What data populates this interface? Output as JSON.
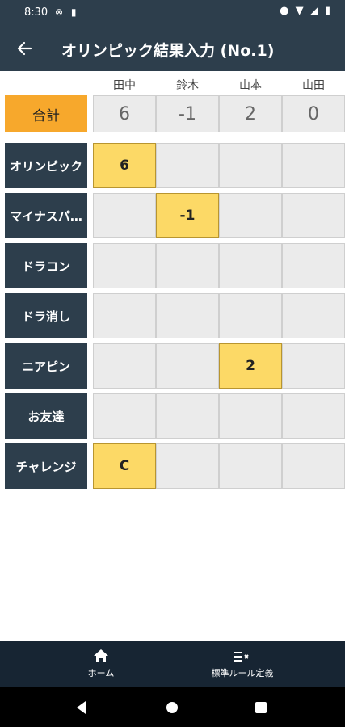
{
  "status": {
    "time": "8:30"
  },
  "appbar": {
    "title": "オリンピック結果入力 (No.1)"
  },
  "players": [
    "田中",
    "鈴木",
    "山本",
    "山田"
  ],
  "total": {
    "label": "合計",
    "scores": [
      "6",
      "-1",
      "2",
      "0"
    ]
  },
  "rows": [
    {
      "label": "オリンピック",
      "scores": [
        "6",
        "",
        "",
        ""
      ]
    },
    {
      "label": "マイナスパ…",
      "scores": [
        "",
        "-1",
        "",
        ""
      ]
    },
    {
      "label": "ドラコン",
      "scores": [
        "",
        "",
        "",
        ""
      ]
    },
    {
      "label": "ドラ消し",
      "scores": [
        "",
        "",
        "",
        ""
      ]
    },
    {
      "label": "ニアピン",
      "scores": [
        "",
        "",
        "2",
        ""
      ]
    },
    {
      "label": "お友達",
      "scores": [
        "",
        "",
        "",
        ""
      ]
    },
    {
      "label": "チャレンジ",
      "scores": [
        "C",
        "",
        "",
        ""
      ]
    }
  ],
  "bottom_nav": [
    {
      "label": "ホーム",
      "icon": "home-icon"
    },
    {
      "label": "標準ルール定義",
      "icon": "rule-list-icon"
    }
  ]
}
